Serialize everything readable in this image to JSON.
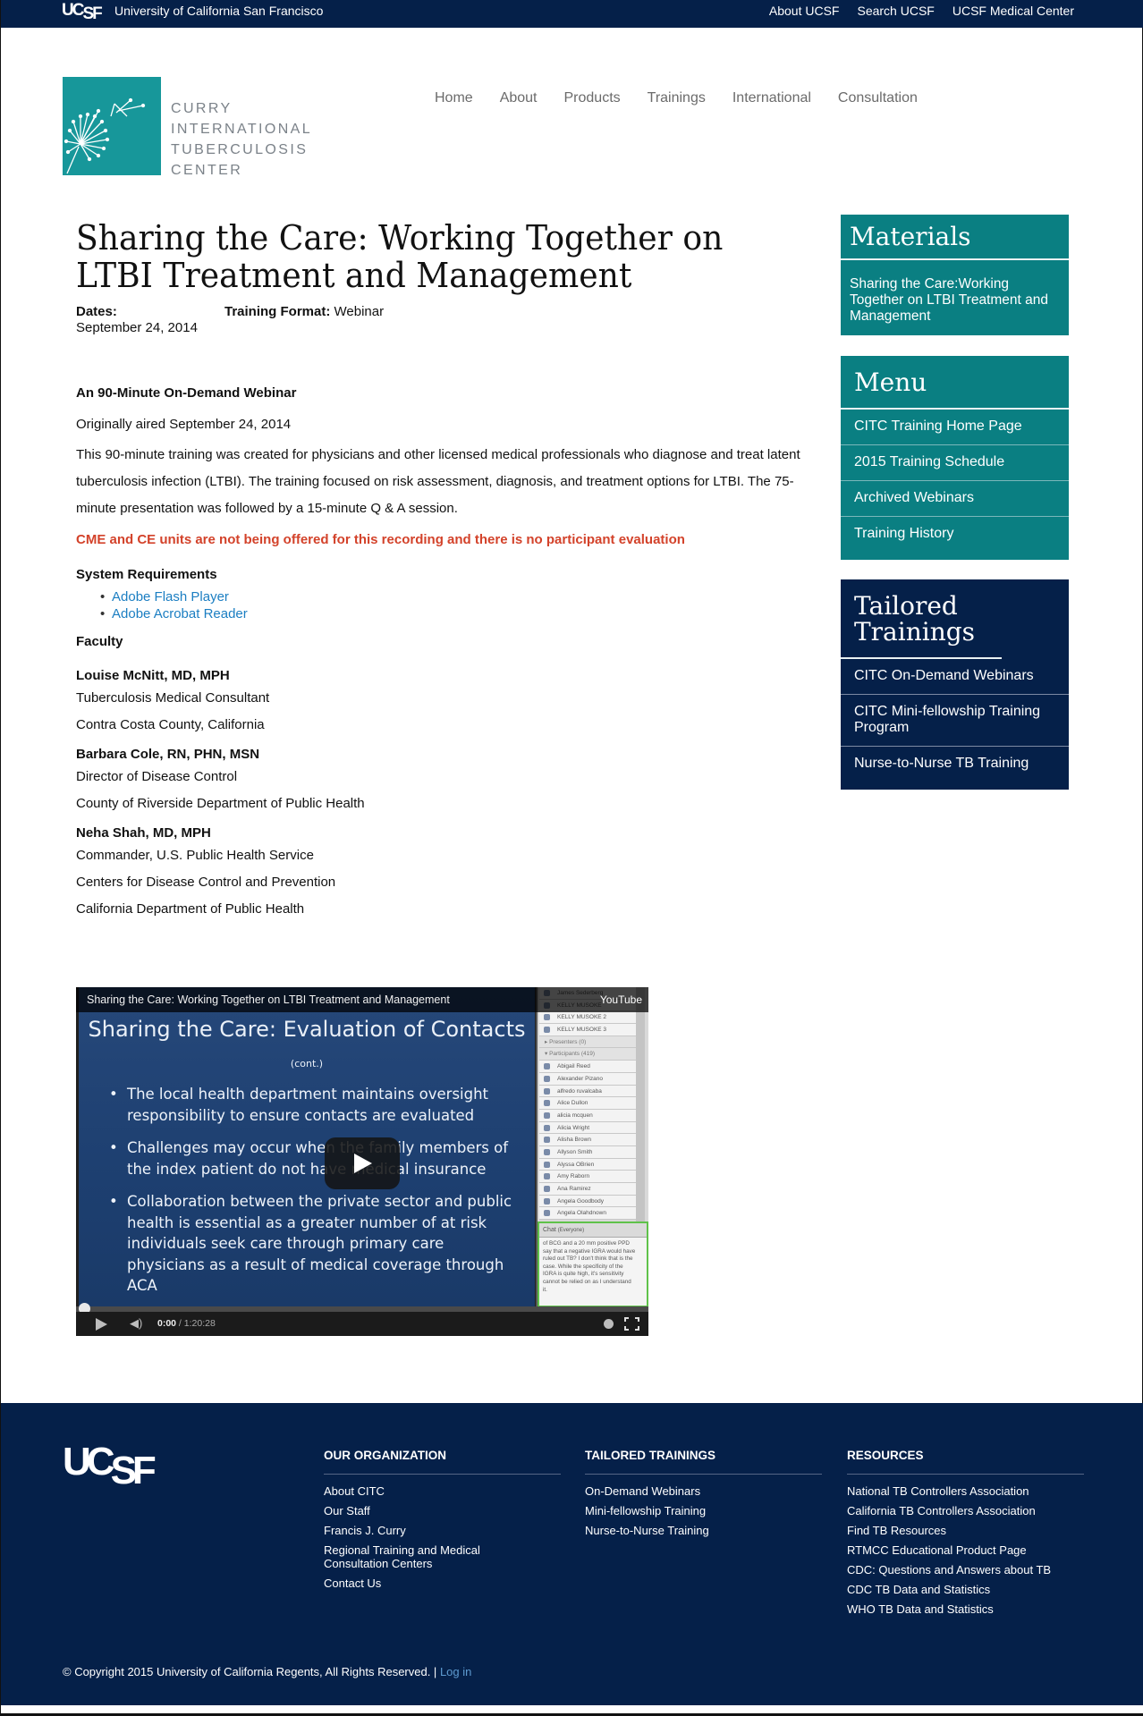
{
  "topbar": {
    "logo": {
      "uc": "UC",
      "sf": "SF"
    },
    "university": "University of California San Francisco",
    "links": [
      "About UCSF",
      "Search UCSF",
      "UCSF Medical Center"
    ]
  },
  "header": {
    "logo_lines": [
      "CURRY",
      "INTERNATIONAL",
      "TUBERCULOSIS",
      "CENTER"
    ],
    "nav": [
      "Home",
      "About",
      "Products",
      "Trainings",
      "International",
      "Consultation"
    ]
  },
  "page": {
    "title": "Sharing the Care: Working Together on LTBI Treatment and Management",
    "dates_label": "Dates:",
    "dates_value": "September 24, 2014",
    "format_label": "Training Format:",
    "format_value": "Webinar",
    "subhead": "An 90-Minute On-Demand Webinar",
    "aired": "Originally aired September 24, 2014",
    "description": "This 90-minute training was created for physicians and other licensed medical professionals who diagnose and treat latent tuberculosis infection (LTBI). The training focused on risk assessment, diagnosis, and treatment options for LTBI. The 75-minute presentation was followed by a 15-minute Q & A session.",
    "warning": "CME and CE units are not being offered for this recording and there is no participant evaluation",
    "warning_color": "#d3422a",
    "sysreq_title": "System Requirements",
    "sysreq_links": [
      "Adobe Flash Player",
      "Adobe Acrobat Reader"
    ],
    "faculty_title": "Faculty",
    "faculty": [
      {
        "name": "Louise McNitt, MD, MPH",
        "lines": [
          "Tuberculosis Medical Consultant",
          "Contra Costa County, California"
        ]
      },
      {
        "name": "Barbara Cole, RN, PHN, MSN",
        "lines": [
          "Director of Disease Control",
          "County of Riverside Department of Public Health"
        ]
      },
      {
        "name": "Neha Shah, MD, MPH",
        "lines": [
          "Commander, U.S. Public Health Service",
          "Centers for Disease Control and Prevention",
          "California Department of Public Health"
        ]
      }
    ]
  },
  "video": {
    "title": "Sharing the Care: Working Together on LTBI Treatment and Management",
    "brand": "YouTube",
    "slide_title": "Sharing the Care: Evaluation of Contacts",
    "slide_title_suffix": "(cont.)",
    "slide_bullets": [
      "The local health department maintains oversight responsibility to ensure contacts are evaluated",
      "Challenges may occur when the family members of the index patient do not have medical insurance",
      "Collaboration between the private sector and public health is essential as a greater number of at risk individuals seek care through primary care physicians as a result of medical coverage through ACA"
    ],
    "side_rows": [
      {
        "text": "James Sederberg",
        "type": "person"
      },
      {
        "text": "KELLY MUSOKE",
        "type": "person"
      },
      {
        "text": "KELLY MUSOKE 2",
        "type": "person"
      },
      {
        "text": "KELLY MUSOKE 3",
        "type": "person"
      },
      {
        "text": "▸ Presenters (0)",
        "type": "group"
      },
      {
        "text": "▾ Participants (419)",
        "type": "group"
      },
      {
        "text": "Abigail Reed",
        "type": "person"
      },
      {
        "text": "Alexander Pizano",
        "type": "person"
      },
      {
        "text": "alfredo ruvalcaba",
        "type": "person"
      },
      {
        "text": "Alice Dullon",
        "type": "person"
      },
      {
        "text": "alicia mcquen",
        "type": "person"
      },
      {
        "text": "Alicia Wright",
        "type": "person"
      },
      {
        "text": "Alisha Brown",
        "type": "person"
      },
      {
        "text": "Allyson Smith",
        "type": "person"
      },
      {
        "text": "Alyssa OBrien",
        "type": "person"
      },
      {
        "text": "Amy Raborn",
        "type": "person"
      },
      {
        "text": "Ana Ramirez",
        "type": "person"
      },
      {
        "text": "Angela Goodbody",
        "type": "person"
      },
      {
        "text": "Angela Olahdnown",
        "type": "person"
      }
    ],
    "chat_header": "Chat",
    "chat_scope": "(Everyone)",
    "chat_text": "of BCG and a 20 mm positive PPD say that a negative IGRA would have ruled out TB? I don't think that is the case. While the specificity of the IGRA is quite high, it's sensitivity cannot be relied on as I understand it.",
    "time_current": "0:00",
    "time_total": "1:20:28",
    "progress": 0
  },
  "sidebar": {
    "materials": {
      "title": "Materials",
      "items": [
        "Sharing the Care:Working Together on LTBI Treatment and Management"
      ]
    },
    "menu": {
      "title": "Menu",
      "items": [
        "CITC Training Home Page",
        "2015 Training Schedule",
        "Archived Webinars",
        "Training History"
      ]
    },
    "tailored": {
      "title": "Tailored Trainings",
      "items": [
        "CITC On-Demand Webinars",
        "CITC Mini-fellowship Training Program",
        "Nurse-to-Nurse TB Training"
      ]
    }
  },
  "footer": {
    "logo": {
      "uc": "UC",
      "sf": "SF"
    },
    "columns": [
      {
        "title": "OUR ORGANIZATION",
        "links": [
          "About CITC",
          "Our Staff",
          "Francis J. Curry",
          "Regional Training and Medical Consultation Centers",
          "Contact Us"
        ]
      },
      {
        "title": "TAILORED TRAININGS",
        "links": [
          "On-Demand Webinars",
          "Mini-fellowship Training",
          "Nurse-to-Nurse Training"
        ]
      },
      {
        "title": "RESOURCES",
        "links": [
          "National TB Controllers Association",
          "California TB Controllers Association",
          "Find TB Resources",
          "RTMCC Educational Product Page",
          "CDC: Questions and Answers about TB",
          "CDC TB Data and Statistics",
          "WHO TB Data and Statistics"
        ]
      }
    ],
    "copyright": "© Copyright 2015 University of California Regents, All Rights Reserved. |",
    "login": "Log in"
  },
  "colors": {
    "navy": "#052049",
    "teal": "#0a7f82",
    "logo_teal": "#17979a",
    "link_blue": "#1b7ec2"
  }
}
